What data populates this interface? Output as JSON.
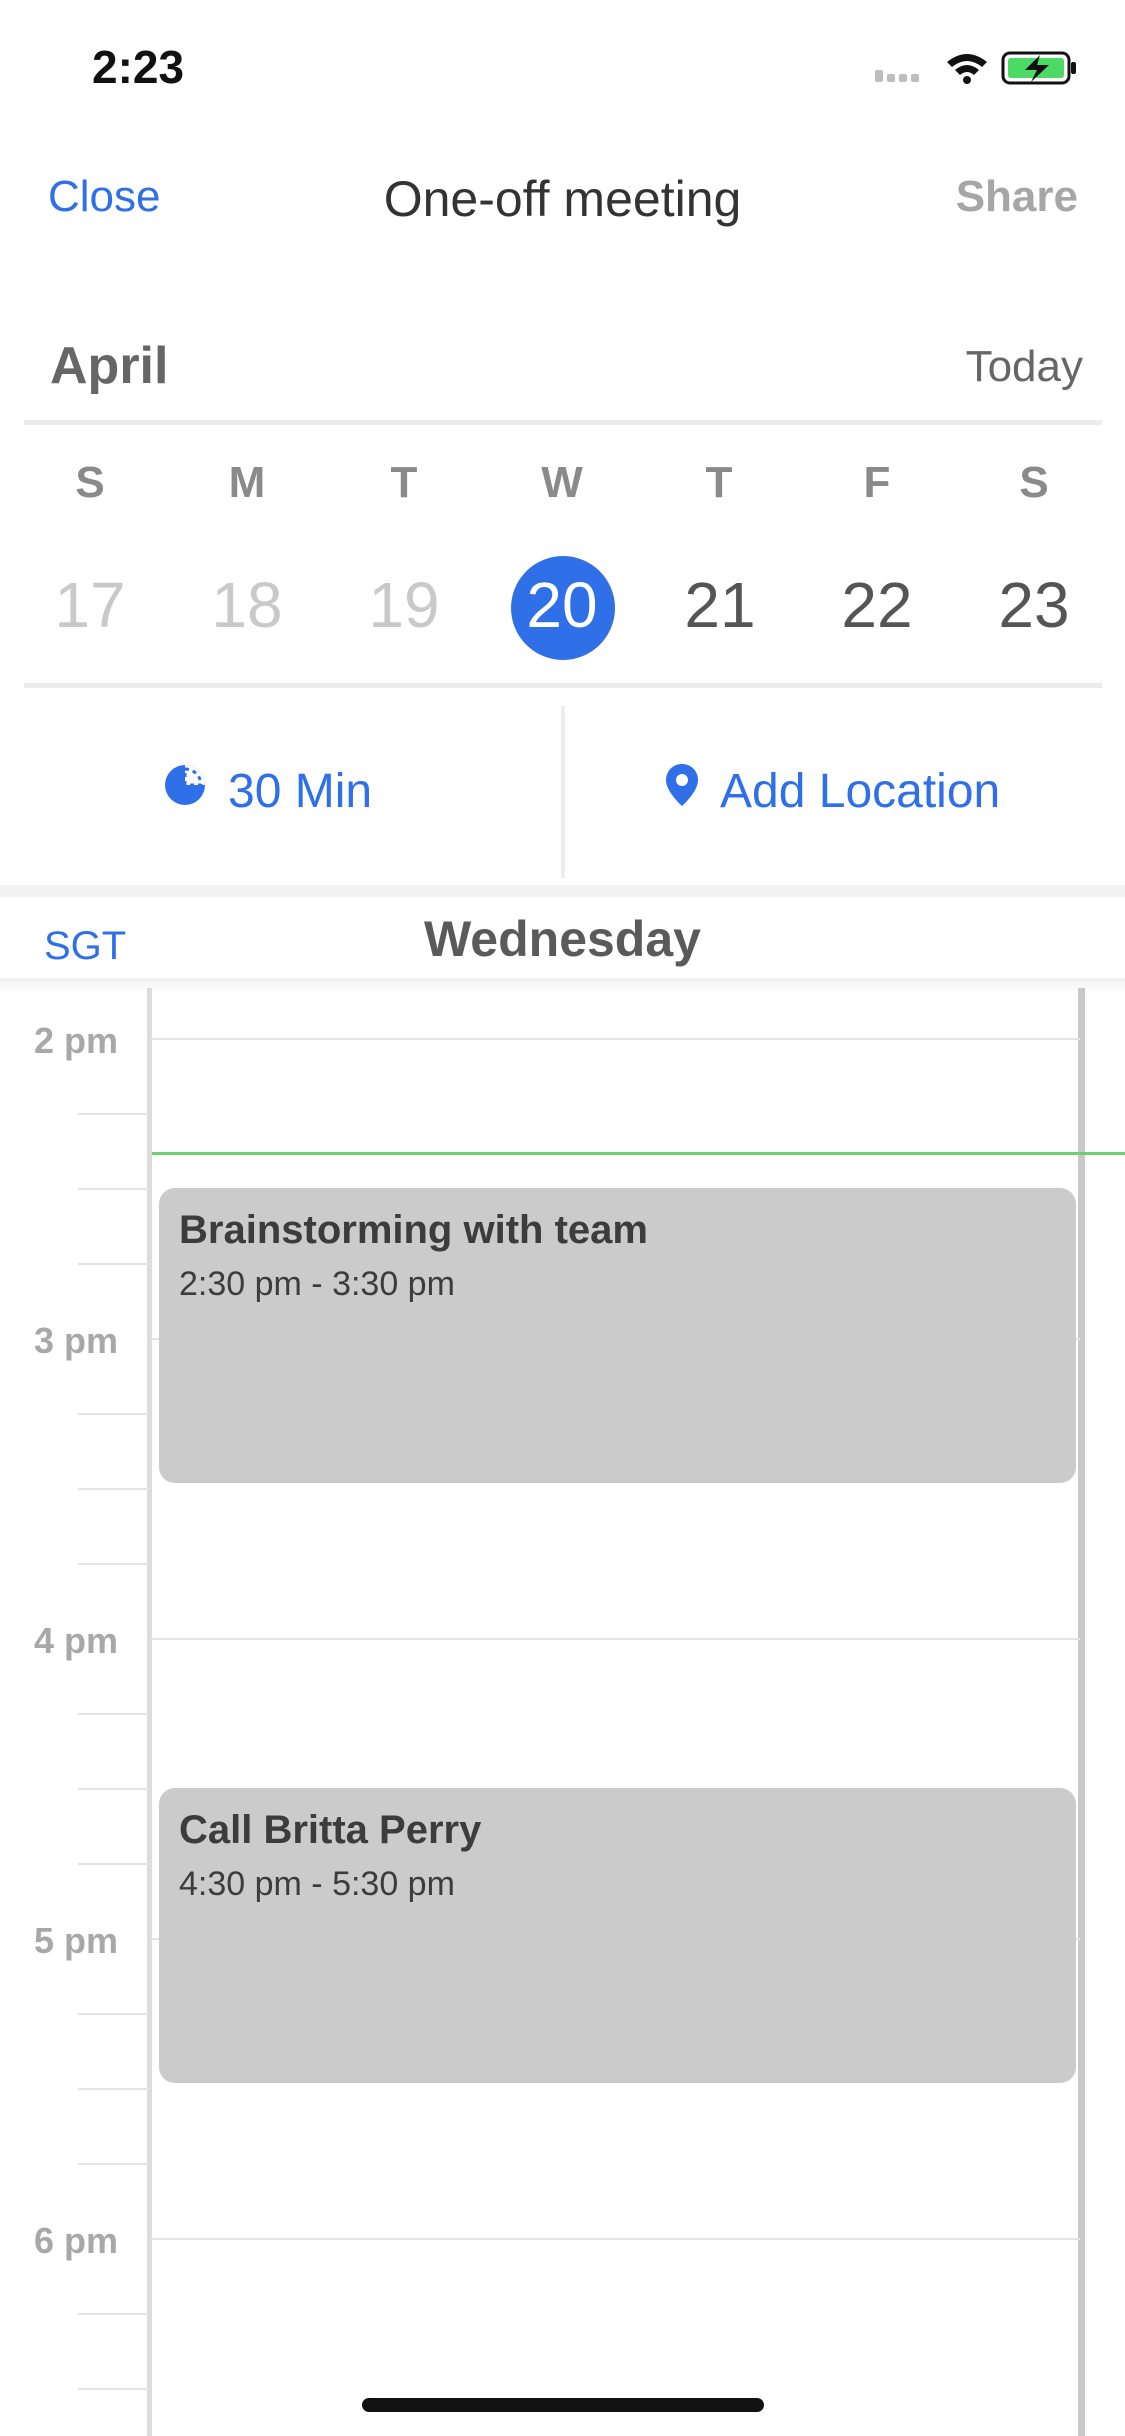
{
  "status": {
    "time": "2:23"
  },
  "nav": {
    "close": "Close",
    "title": "One-off meeting",
    "share": "Share"
  },
  "calendar": {
    "month": "April",
    "today": "Today",
    "weekdays": [
      "S",
      "M",
      "T",
      "W",
      "T",
      "F",
      "S"
    ],
    "days": [
      "17",
      "18",
      "19",
      "20",
      "21",
      "22",
      "23"
    ],
    "selected_day": "20"
  },
  "options": {
    "duration": "30 Min",
    "location": "Add Location"
  },
  "day_view": {
    "timezone": "SGT",
    "day_name": "Wednesday",
    "hours": [
      "2 pm",
      "3 pm",
      "4 pm",
      "5 pm",
      "6 pm"
    ]
  },
  "events": [
    {
      "title": "Brainstorming with team",
      "time": "2:30 pm - 3:30 pm"
    },
    {
      "title": "Call Britta Perry",
      "time": "4:30 pm - 5:30 pm"
    }
  ],
  "colors": {
    "accent": "#2f6fe8",
    "event_bg": "#cbcbcb",
    "now_line": "#6fcf6f"
  }
}
